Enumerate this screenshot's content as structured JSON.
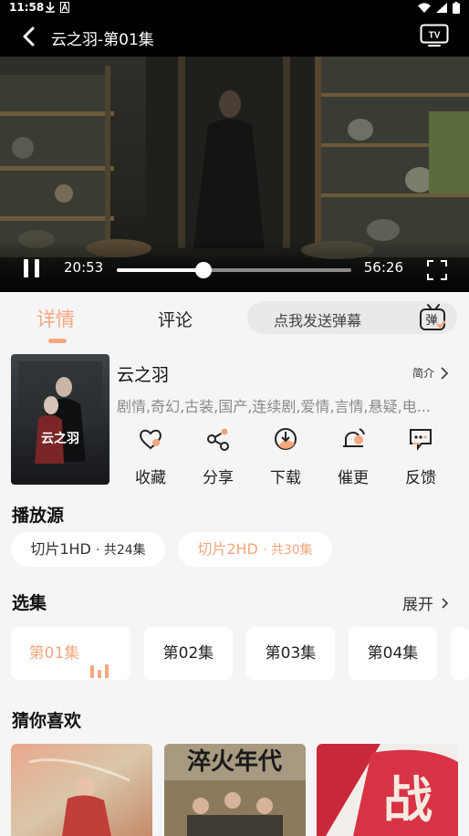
{
  "status_bar": {
    "time": "11:58"
  },
  "header": {
    "title": "云之羽-第01集",
    "tv_label": "TV"
  },
  "player": {
    "current_time": "20:53",
    "duration": "56:26",
    "progress": 0.37
  },
  "tabs": [
    {
      "label": "详情",
      "active": true
    },
    {
      "label": "评论",
      "active": false
    }
  ],
  "danmaku": {
    "placeholder": "点我发送弹幕",
    "icon_text": "弹"
  },
  "drama": {
    "title": "云之羽",
    "intro_label": "简介",
    "tags": "剧情,奇幻,古装,国产,连续剧,爱情,言情,悬疑,电...",
    "poster_text": "云之羽"
  },
  "actions": [
    {
      "label": "收藏",
      "icon": "heart-icon"
    },
    {
      "label": "分享",
      "icon": "share-icon"
    },
    {
      "label": "下载",
      "icon": "download-icon"
    },
    {
      "label": "催更",
      "icon": "bell-icon"
    },
    {
      "label": "反馈",
      "icon": "feedback-icon"
    }
  ],
  "sources": {
    "title": "播放源",
    "items": [
      {
        "name": "切片1HD",
        "count": "· 共24集",
        "selected": false
      },
      {
        "name": "切片2HD",
        "count": "· 共30集",
        "selected": true
      }
    ]
  },
  "episodes": {
    "title": "选集",
    "expand_label": "展开",
    "items": [
      "第01集",
      "第02集",
      "第03集",
      "第04集"
    ],
    "playing_index": 0
  },
  "recommend": {
    "title": "猜你喜欢",
    "items": [
      {
        "art_text": ""
      },
      {
        "art_text": "淬火年代"
      },
      {
        "art_text": "战"
      }
    ]
  },
  "colors": {
    "accent": "#f5a77d",
    "background": "#f5f5f5",
    "header": "#000000"
  }
}
